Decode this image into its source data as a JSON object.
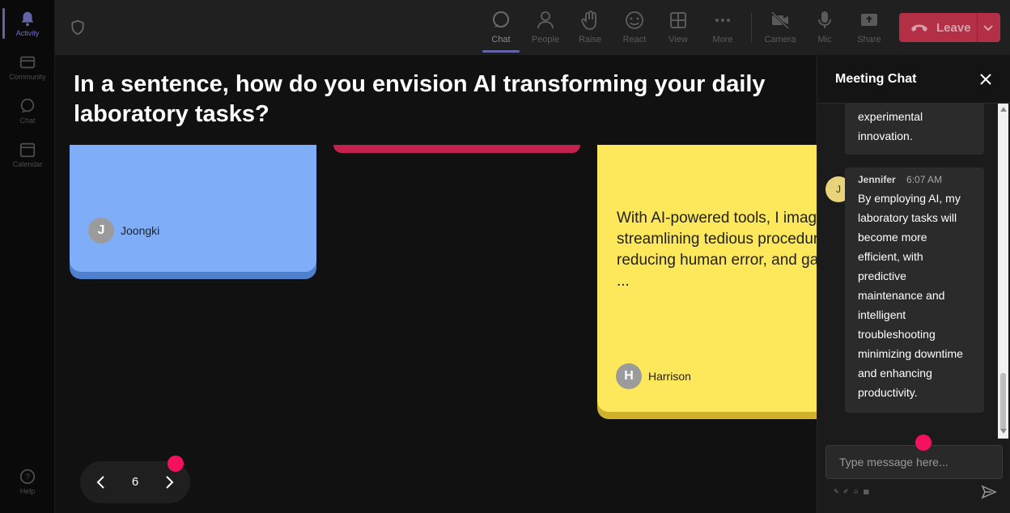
{
  "rail": {
    "items": [
      {
        "label": "Activity",
        "icon": "bell-icon",
        "active": true
      },
      {
        "label": "Community",
        "icon": "community-icon"
      },
      {
        "label": "Chat",
        "icon": "chat-icon"
      },
      {
        "label": "Calendar",
        "icon": "calendar-icon"
      }
    ],
    "help": {
      "label": "Help",
      "icon": "help-icon"
    }
  },
  "toolbar": {
    "items": [
      {
        "label": "Chat",
        "icon": "chat-icon",
        "active": true
      },
      {
        "label": "People",
        "icon": "people-icon"
      },
      {
        "label": "Raise",
        "icon": "raise-hand-icon"
      },
      {
        "label": "React",
        "icon": "react-icon"
      },
      {
        "label": "View",
        "icon": "view-grid-icon"
      },
      {
        "label": "More",
        "icon": "more-icon"
      },
      {
        "label": "Camera",
        "icon": "camera-off-icon"
      },
      {
        "label": "Mic",
        "icon": "mic-icon"
      },
      {
        "label": "Share",
        "icon": "share-icon"
      }
    ],
    "leave_label": "Leave",
    "leave_color": "#c4314b",
    "accent_color": "#6264a7"
  },
  "stage": {
    "question": "In a sentence, how do you envision AI transforming your daily laboratory tasks?",
    "cards": [
      {
        "color": "#7fadf8",
        "author": "Joongki",
        "initial": "J",
        "text": ""
      },
      {
        "color": "#c4214f",
        "author": "",
        "initial": "",
        "text": ""
      },
      {
        "color": "#fde75b",
        "author": "Harrison",
        "initial": "H",
        "text": "With AI-powered tools, I imagine streamlining tedious procedures, reducing human error, and gaining ..."
      }
    ],
    "pager": {
      "current_page": "6"
    },
    "highlight_color": "#f5115f"
  },
  "chat": {
    "title": "Meeting Chat",
    "messages": [
      {
        "author": "",
        "time": "",
        "text": "experimental innovation."
      },
      {
        "author": "Jennifer",
        "initial": "J",
        "time": "6:07 AM",
        "text": "By employing AI, my laboratory tasks will become more efficient, with predictive maintenance and intelligent troubleshooting minimizing downtime and enhancing productivity."
      }
    ],
    "input_placeholder": "Type message here..."
  }
}
